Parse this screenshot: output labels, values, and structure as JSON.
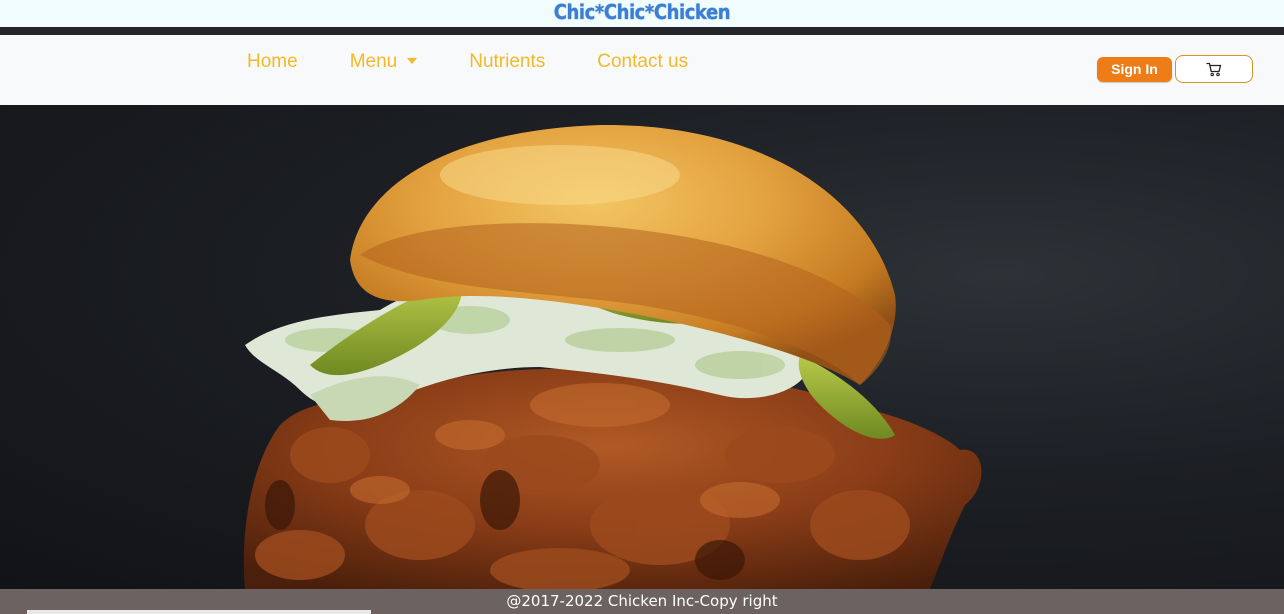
{
  "header": {
    "brand": "Chic*Chic*Chicken"
  },
  "nav": {
    "items": [
      {
        "label": "Home"
      },
      {
        "label": "Menu"
      },
      {
        "label": "Nutrients"
      },
      {
        "label": "Contact us"
      }
    ],
    "signin_label": "Sign In"
  },
  "icons": {
    "menu_caret": "chevron-down-icon",
    "cart": "shopping-cart-icon"
  },
  "hero": {
    "subject": "fried chicken sandwich photo"
  },
  "footer": {
    "copyright": "@2017-2022 Chicken Inc-Copy right"
  },
  "colors": {
    "brand": "#3a7fd5",
    "nav_link": "#f3b928",
    "signin": "#ef7d17",
    "cart_border": "#d7922a",
    "footer_bg": "#6d6262"
  }
}
